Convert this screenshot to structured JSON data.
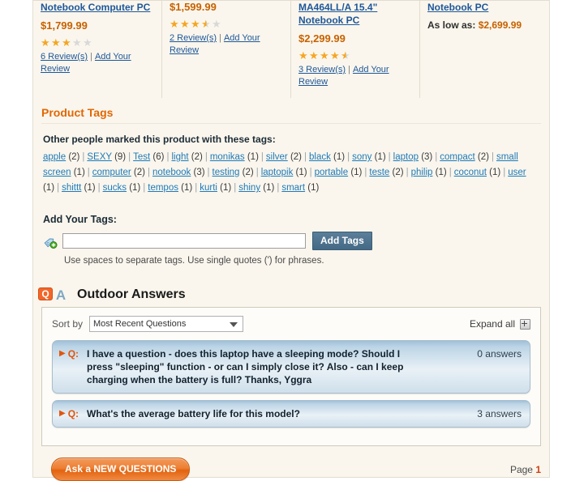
{
  "products": [
    {
      "name": "Notebook Computer PC",
      "price": "$1,799.99",
      "price_prefix": "",
      "rating": 3,
      "reviews_link": "6 Review(s)",
      "add_review_link": "Add Your Review",
      "separator": "|"
    },
    {
      "name": "",
      "price": "$1,599.99",
      "price_prefix": "",
      "rating": 3.5,
      "reviews_link": "2 Review(s)",
      "add_review_link": "Add Your Review",
      "separator": "|"
    },
    {
      "name": "MA464LL/A 15.4\" Notebook PC",
      "price": "$2,299.99",
      "price_prefix": "",
      "rating": 4.5,
      "reviews_link": "3 Review(s)",
      "add_review_link": "Add Your Review",
      "separator": "|"
    },
    {
      "name": "Notebook PC",
      "price": "$2,699.99",
      "price_prefix": "As low as:",
      "rating": 0,
      "reviews_link": "",
      "add_review_link": "",
      "separator": ""
    }
  ],
  "product_tags": {
    "title": "Product Tags",
    "lead": "Other people marked this product with these tags:",
    "tags": [
      {
        "label": "apple",
        "count": "(2)"
      },
      {
        "label": "SEXY",
        "count": "(9)"
      },
      {
        "label": "Test",
        "count": "(6)"
      },
      {
        "label": "light",
        "count": "(2)"
      },
      {
        "label": "monikas",
        "count": "(1)"
      },
      {
        "label": "silver",
        "count": "(2)"
      },
      {
        "label": "black",
        "count": "(1)"
      },
      {
        "label": "sony",
        "count": "(1)"
      },
      {
        "label": "laptop",
        "count": "(3)"
      },
      {
        "label": "compact",
        "count": "(2)"
      },
      {
        "label": "small screen",
        "count": "(1)"
      },
      {
        "label": "computer",
        "count": "(2)"
      },
      {
        "label": "notebook",
        "count": "(3)"
      },
      {
        "label": "testing",
        "count": "(2)"
      },
      {
        "label": "laptopik",
        "count": "(1)"
      },
      {
        "label": "portable",
        "count": "(1)"
      },
      {
        "label": "teste",
        "count": "(2)"
      },
      {
        "label": "philip",
        "count": "(1)"
      },
      {
        "label": "coconut",
        "count": "(1)"
      },
      {
        "label": "user",
        "count": "(1)"
      },
      {
        "label": "shittt",
        "count": "(1)"
      },
      {
        "label": "sucks",
        "count": "(1)"
      },
      {
        "label": "tempos",
        "count": "(1)"
      },
      {
        "label": "kurti",
        "count": "(1)"
      },
      {
        "label": "shiny",
        "count": "(1)"
      },
      {
        "label": "smart",
        "count": "(1)"
      }
    ],
    "tag_divider": "|"
  },
  "add_tags": {
    "label": "Add Your Tags:",
    "input_value": "",
    "input_placeholder": "",
    "button_label": "Add Tags",
    "hint": "Use spaces to separate tags. Use single quotes (') for phrases."
  },
  "qa": {
    "logo_text_q": "Q",
    "logo_text_a": "A",
    "title": "Outdoor Answers",
    "sort_by_label": "Sort by",
    "sort_selected": "Most Recent Questions",
    "expand_all_label": "Expand all",
    "q_prefix": "Q:",
    "questions": [
      {
        "text": "I have a question - does this laptop have a sleeping mode? Should I press \"sleeping\" function - or can I simply close it? Also - can I keep charging when the battery is full? Thanks, Yggra",
        "answers": "0 answers"
      },
      {
        "text": "What's the average battery life for this model?",
        "answers": "3 answers"
      }
    ],
    "ask_button_label": "Ask a NEW QUESTIONS",
    "page_label": "Page",
    "page_number": "1"
  },
  "colors": {
    "accent_orange": "#e26703",
    "link_blue": "#1e7ab8",
    "price_orange": "#c76200",
    "star_on": "#f5a623",
    "star_off": "#d8d8d8",
    "page_bg": "#faf6ed"
  }
}
